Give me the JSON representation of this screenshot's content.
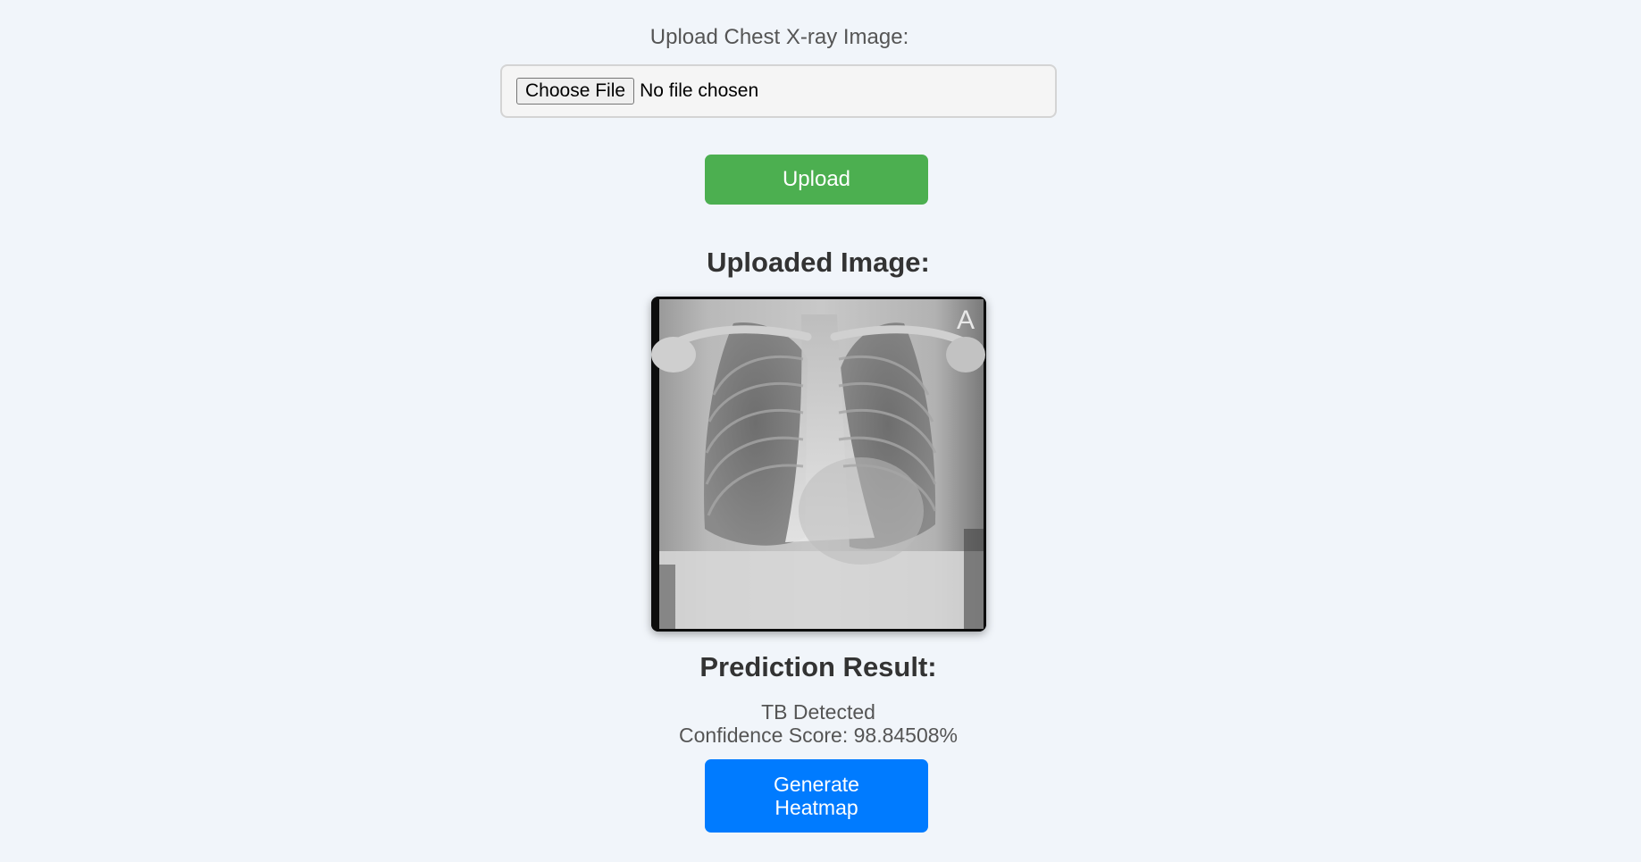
{
  "upload": {
    "label": "Upload Chest X-ray Image:",
    "choose_button_label": "Choose File",
    "file_status": "No file chosen",
    "submit_label": "Upload"
  },
  "uploaded_image": {
    "heading": "Uploaded Image:",
    "marker": "A"
  },
  "prediction": {
    "heading": "Prediction Result:",
    "result": "TB Detected",
    "confidence": "Confidence Score: 98.84508%"
  },
  "heatmap": {
    "button_label": "Generate Heatmap"
  },
  "colors": {
    "background": "#f1f5fa",
    "upload_button": "#4caf50",
    "heatmap_button": "#007bff",
    "heading_text": "#333333",
    "body_text": "#555555"
  }
}
